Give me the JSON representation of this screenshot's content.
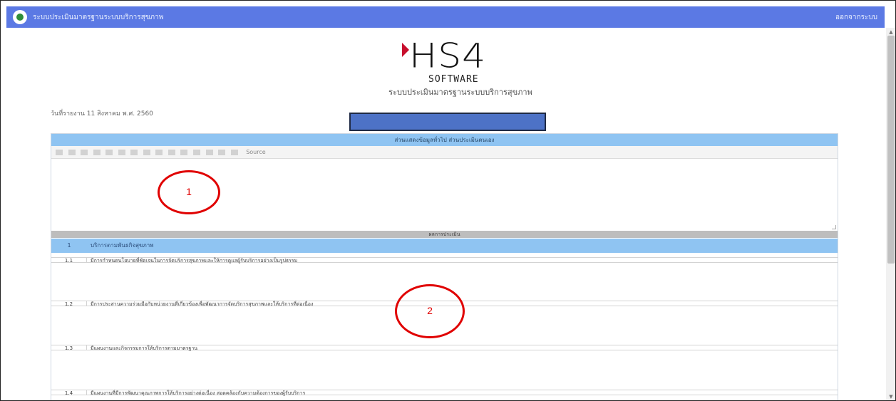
{
  "topbar": {
    "title": "ระบบประเมินมาตรฐานระบบบริการสุขภาพ",
    "user_label": "ออกจากระบบ"
  },
  "brand": {
    "wordmark": "HS4",
    "sub": "SOFTWARE",
    "caption": "ระบบประเมินมาตรฐานระบบบริการสุขภาพ",
    "accent_color": "#c8102e"
  },
  "print_date": "วันที่รายงาน 11 สิงหาคม พ.ศ. 2560",
  "panel": {
    "header": "ส่วนแสดงข้อมูลทั่วไป ส่วนประเมินตนเอง",
    "toolbar_source_label": "Source",
    "section_header": "ผลการประเมิน",
    "category": {
      "num": "1",
      "text": "บริการตามพันธกิจสุขภาพ"
    },
    "items": [
      {
        "num": "1.1",
        "text": "มีการกำหนดนโยบายที่ชัดเจนในการจัดบริการสุขภาพและให้การดูแลผู้รับบริการอย่างเป็นรูปธรรม"
      },
      {
        "num": "1.2",
        "text": "มีการประสานความร่วมมือกับหน่วยงานที่เกี่ยวข้องเพื่อพัฒนาการจัดบริการสุขภาพและให้บริการที่ต่อเนื่อง"
      },
      {
        "num": "1.3",
        "text": "มีแผนงานและกิจกรรมการให้บริการตามมาตรฐาน"
      },
      {
        "num": "1.4",
        "text": "มีแผนงานที่มีการพัฒนาคุณภาพการให้บริการอย่างต่อเนื่อง สอดคล้องกับความต้องการของผู้รับบริการ"
      }
    ]
  },
  "annotations": [
    "1",
    "2"
  ]
}
